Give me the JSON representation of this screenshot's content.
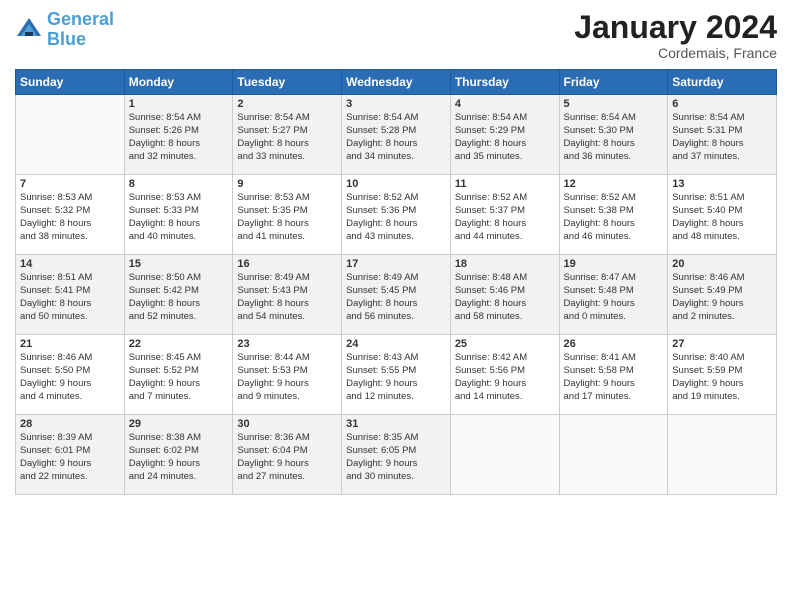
{
  "logo": {
    "line1": "General",
    "line2": "Blue"
  },
  "title": "January 2024",
  "subtitle": "Cordemais, France",
  "header_days": [
    "Sunday",
    "Monday",
    "Tuesday",
    "Wednesday",
    "Thursday",
    "Friday",
    "Saturday"
  ],
  "weeks": [
    [
      {
        "day": "",
        "sunrise": "",
        "sunset": "",
        "daylight": ""
      },
      {
        "day": "1",
        "sunrise": "Sunrise: 8:54 AM",
        "sunset": "Sunset: 5:26 PM",
        "daylight": "Daylight: 8 hours and 32 minutes."
      },
      {
        "day": "2",
        "sunrise": "Sunrise: 8:54 AM",
        "sunset": "Sunset: 5:27 PM",
        "daylight": "Daylight: 8 hours and 33 minutes."
      },
      {
        "day": "3",
        "sunrise": "Sunrise: 8:54 AM",
        "sunset": "Sunset: 5:28 PM",
        "daylight": "Daylight: 8 hours and 34 minutes."
      },
      {
        "day": "4",
        "sunrise": "Sunrise: 8:54 AM",
        "sunset": "Sunset: 5:29 PM",
        "daylight": "Daylight: 8 hours and 35 minutes."
      },
      {
        "day": "5",
        "sunrise": "Sunrise: 8:54 AM",
        "sunset": "Sunset: 5:30 PM",
        "daylight": "Daylight: 8 hours and 36 minutes."
      },
      {
        "day": "6",
        "sunrise": "Sunrise: 8:54 AM",
        "sunset": "Sunset: 5:31 PM",
        "daylight": "Daylight: 8 hours and 37 minutes."
      }
    ],
    [
      {
        "day": "7",
        "sunrise": "Sunrise: 8:53 AM",
        "sunset": "Sunset: 5:32 PM",
        "daylight": "Daylight: 8 hours and 38 minutes."
      },
      {
        "day": "8",
        "sunrise": "Sunrise: 8:53 AM",
        "sunset": "Sunset: 5:33 PM",
        "daylight": "Daylight: 8 hours and 40 minutes."
      },
      {
        "day": "9",
        "sunrise": "Sunrise: 8:53 AM",
        "sunset": "Sunset: 5:35 PM",
        "daylight": "Daylight: 8 hours and 41 minutes."
      },
      {
        "day": "10",
        "sunrise": "Sunrise: 8:52 AM",
        "sunset": "Sunset: 5:36 PM",
        "daylight": "Daylight: 8 hours and 43 minutes."
      },
      {
        "day": "11",
        "sunrise": "Sunrise: 8:52 AM",
        "sunset": "Sunset: 5:37 PM",
        "daylight": "Daylight: 8 hours and 44 minutes."
      },
      {
        "day": "12",
        "sunrise": "Sunrise: 8:52 AM",
        "sunset": "Sunset: 5:38 PM",
        "daylight": "Daylight: 8 hours and 46 minutes."
      },
      {
        "day": "13",
        "sunrise": "Sunrise: 8:51 AM",
        "sunset": "Sunset: 5:40 PM",
        "daylight": "Daylight: 8 hours and 48 minutes."
      }
    ],
    [
      {
        "day": "14",
        "sunrise": "Sunrise: 8:51 AM",
        "sunset": "Sunset: 5:41 PM",
        "daylight": "Daylight: 8 hours and 50 minutes."
      },
      {
        "day": "15",
        "sunrise": "Sunrise: 8:50 AM",
        "sunset": "Sunset: 5:42 PM",
        "daylight": "Daylight: 8 hours and 52 minutes."
      },
      {
        "day": "16",
        "sunrise": "Sunrise: 8:49 AM",
        "sunset": "Sunset: 5:43 PM",
        "daylight": "Daylight: 8 hours and 54 minutes."
      },
      {
        "day": "17",
        "sunrise": "Sunrise: 8:49 AM",
        "sunset": "Sunset: 5:45 PM",
        "daylight": "Daylight: 8 hours and 56 minutes."
      },
      {
        "day": "18",
        "sunrise": "Sunrise: 8:48 AM",
        "sunset": "Sunset: 5:46 PM",
        "daylight": "Daylight: 8 hours and 58 minutes."
      },
      {
        "day": "19",
        "sunrise": "Sunrise: 8:47 AM",
        "sunset": "Sunset: 5:48 PM",
        "daylight": "Daylight: 9 hours and 0 minutes."
      },
      {
        "day": "20",
        "sunrise": "Sunrise: 8:46 AM",
        "sunset": "Sunset: 5:49 PM",
        "daylight": "Daylight: 9 hours and 2 minutes."
      }
    ],
    [
      {
        "day": "21",
        "sunrise": "Sunrise: 8:46 AM",
        "sunset": "Sunset: 5:50 PM",
        "daylight": "Daylight: 9 hours and 4 minutes."
      },
      {
        "day": "22",
        "sunrise": "Sunrise: 8:45 AM",
        "sunset": "Sunset: 5:52 PM",
        "daylight": "Daylight: 9 hours and 7 minutes."
      },
      {
        "day": "23",
        "sunrise": "Sunrise: 8:44 AM",
        "sunset": "Sunset: 5:53 PM",
        "daylight": "Daylight: 9 hours and 9 minutes."
      },
      {
        "day": "24",
        "sunrise": "Sunrise: 8:43 AM",
        "sunset": "Sunset: 5:55 PM",
        "daylight": "Daylight: 9 hours and 12 minutes."
      },
      {
        "day": "25",
        "sunrise": "Sunrise: 8:42 AM",
        "sunset": "Sunset: 5:56 PM",
        "daylight": "Daylight: 9 hours and 14 minutes."
      },
      {
        "day": "26",
        "sunrise": "Sunrise: 8:41 AM",
        "sunset": "Sunset: 5:58 PM",
        "daylight": "Daylight: 9 hours and 17 minutes."
      },
      {
        "day": "27",
        "sunrise": "Sunrise: 8:40 AM",
        "sunset": "Sunset: 5:59 PM",
        "daylight": "Daylight: 9 hours and 19 minutes."
      }
    ],
    [
      {
        "day": "28",
        "sunrise": "Sunrise: 8:39 AM",
        "sunset": "Sunset: 6:01 PM",
        "daylight": "Daylight: 9 hours and 22 minutes."
      },
      {
        "day": "29",
        "sunrise": "Sunrise: 8:38 AM",
        "sunset": "Sunset: 6:02 PM",
        "daylight": "Daylight: 9 hours and 24 minutes."
      },
      {
        "day": "30",
        "sunrise": "Sunrise: 8:36 AM",
        "sunset": "Sunset: 6:04 PM",
        "daylight": "Daylight: 9 hours and 27 minutes."
      },
      {
        "day": "31",
        "sunrise": "Sunrise: 8:35 AM",
        "sunset": "Sunset: 6:05 PM",
        "daylight": "Daylight: 9 hours and 30 minutes."
      },
      {
        "day": "",
        "sunrise": "",
        "sunset": "",
        "daylight": ""
      },
      {
        "day": "",
        "sunrise": "",
        "sunset": "",
        "daylight": ""
      },
      {
        "day": "",
        "sunrise": "",
        "sunset": "",
        "daylight": ""
      }
    ]
  ]
}
